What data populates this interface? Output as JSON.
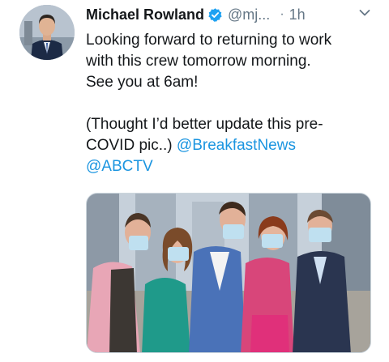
{
  "tweet": {
    "author_name": "Michael Rowland",
    "handle": "@mj...",
    "separator": "·",
    "time": "1h",
    "text_line_1": "Looking forward to returning to work",
    "text_line_2": "with this crew tomorrow morning.",
    "text_line_3": "See you at 6am!",
    "text_line_4": "(Thought I’d better update this pre-",
    "text_line_5_plain": "COVID pic..) ",
    "mention_1": "@BreakfastNews",
    "mention_2": "@ABCTV",
    "verified_icon": "verified-badge-icon",
    "menu_icon": "chevron-down-icon"
  },
  "colors": {
    "accent": "#1b95e0",
    "verified": "#1da1f2",
    "secondary_text": "#657786",
    "primary_text": "#14171a"
  }
}
